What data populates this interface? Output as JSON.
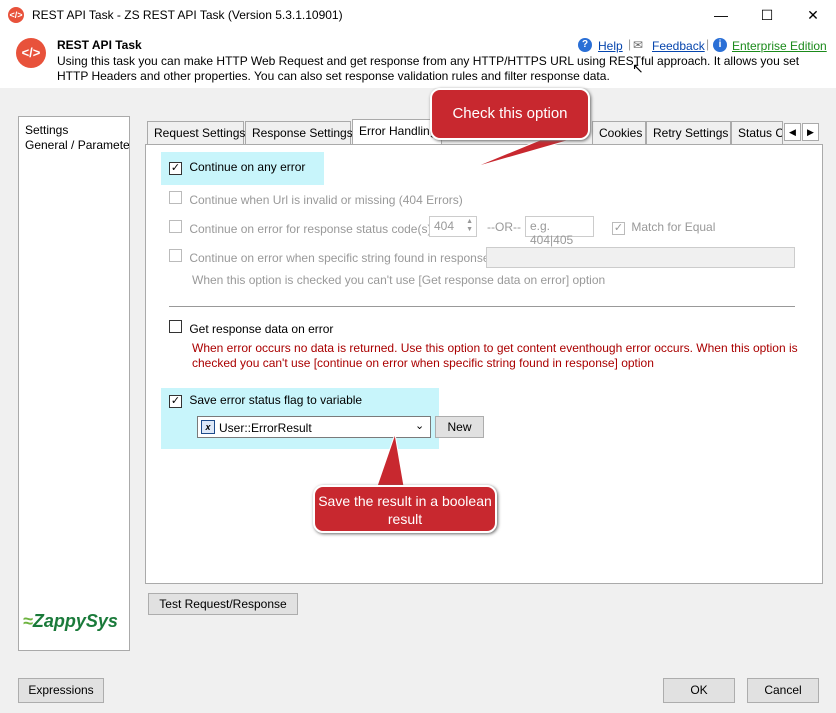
{
  "window": {
    "title": "REST API Task - ZS REST API Task (Version 5.3.1.10901)",
    "icon": "</>"
  },
  "header": {
    "title": "REST API Task",
    "description": "Using this task you can make HTTP Web Request and get response from any HTTP/HTTPS URL using RESTful approach. It allows you set HTTP Headers and other properties. You can also set response validation rules and filter response data.",
    "help": "Help",
    "feedback": "Feedback",
    "edition": "Enterprise Edition"
  },
  "sidebar": {
    "items": [
      "Settings",
      "General / Parameters"
    ]
  },
  "tabs": [
    "Request Settings",
    "Response Settings",
    "Error Handling",
    "Cookies",
    "Retry Settings",
    "Status Ch"
  ],
  "options": {
    "continue_any_error": "Continue on any error",
    "continue_url_invalid": "Continue when Url is invalid or missing (404 Errors)",
    "continue_status_code": "Continue on error for response status code(s)",
    "status_code_value": "404",
    "or_label": "--OR--",
    "status_placeholder": "e.g. 404|405",
    "match_equal": "Match for Equal",
    "continue_string": "Continue on error when specific string found in response",
    "string_note": "When this option is checked you can't use [Get response data on error] option",
    "get_response_data": "Get response data on error",
    "get_response_note": "When error occurs no data is returned. Use this option to get content eventhough error occurs. When this option is checked you can't use [continue on error when specific string found in response] option",
    "save_flag": "Save error status flag to variable",
    "variable_value": "User::ErrorResult",
    "new_button": "New"
  },
  "callouts": {
    "top": "Check this option",
    "bottom": "Save the result in a boolean result"
  },
  "logo": "ZappySys",
  "buttons": {
    "test": "Test Request/Response",
    "expressions": "Expressions",
    "ok": "OK",
    "cancel": "Cancel"
  },
  "colors": {
    "accent_red": "#c8282f",
    "highlight": "#c8f5fb",
    "link": "#0645ad"
  }
}
